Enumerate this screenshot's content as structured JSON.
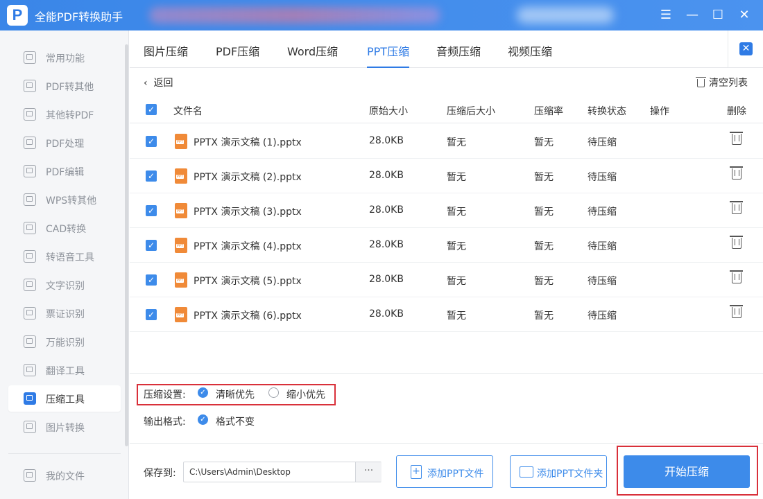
{
  "window": {
    "title": "全能PDF转换助手",
    "logo_text": "P"
  },
  "sidebar": {
    "items": [
      {
        "label": "常用功能"
      },
      {
        "label": "PDF转其他"
      },
      {
        "label": "其他转PDF"
      },
      {
        "label": "PDF处理"
      },
      {
        "label": "PDF编辑"
      },
      {
        "label": "WPS转其他"
      },
      {
        "label": "CAD转换"
      },
      {
        "label": "转语音工具"
      },
      {
        "label": "文字识别"
      },
      {
        "label": "票证识别"
      },
      {
        "label": "万能识别"
      },
      {
        "label": "翻译工具"
      },
      {
        "label": "压缩工具"
      },
      {
        "label": "图片转换"
      }
    ],
    "active_index": 12,
    "my_files": "我的文件"
  },
  "tabs": {
    "items": [
      {
        "label": "图片压缩"
      },
      {
        "label": "PDF压缩"
      },
      {
        "label": "Word压缩"
      },
      {
        "label": "PPT压缩"
      },
      {
        "label": "音频压缩"
      },
      {
        "label": "视频压缩"
      }
    ],
    "active_index": 3
  },
  "toolbar": {
    "back_label": "返回",
    "clear_label": "清空列表"
  },
  "table": {
    "headers": {
      "filename": "文件名",
      "original_size": "原始大小",
      "compressed_size": "压缩后大小",
      "ratio": "压缩率",
      "status": "转换状态",
      "action": "操作",
      "delete": "删除"
    },
    "rows": [
      {
        "name": "PPTX 演示文稿 (1).pptx",
        "size": "28.0KB",
        "compressed": "暂无",
        "ratio": "暂无",
        "status": "待压缩"
      },
      {
        "name": "PPTX 演示文稿 (2).pptx",
        "size": "28.0KB",
        "compressed": "暂无",
        "ratio": "暂无",
        "status": "待压缩"
      },
      {
        "name": "PPTX 演示文稿 (3).pptx",
        "size": "28.0KB",
        "compressed": "暂无",
        "ratio": "暂无",
        "status": "待压缩"
      },
      {
        "name": "PPTX 演示文稿 (4).pptx",
        "size": "28.0KB",
        "compressed": "暂无",
        "ratio": "暂无",
        "status": "待压缩"
      },
      {
        "name": "PPTX 演示文稿 (5).pptx",
        "size": "28.0KB",
        "compressed": "暂无",
        "ratio": "暂无",
        "status": "待压缩"
      },
      {
        "name": "PPTX 演示文稿 (6).pptx",
        "size": "28.0KB",
        "compressed": "暂无",
        "ratio": "暂无",
        "status": "待压缩"
      }
    ]
  },
  "settings": {
    "compress_label": "压缩设置:",
    "option_clear": "清晰优先",
    "option_small": "缩小优先",
    "output_label": "输出格式:",
    "output_option": "格式不变"
  },
  "bottom": {
    "save_label": "保存到:",
    "save_path": "C:\\Users\\Admin\\Desktop",
    "browse_label": "···",
    "add_file": "添加PPT文件",
    "add_folder": "添加PPT文件夹",
    "start": "开始压缩"
  },
  "colors": {
    "accent": "#3d8bea",
    "highlight": "#d9303a",
    "ppt_icon": "#f08a38"
  }
}
